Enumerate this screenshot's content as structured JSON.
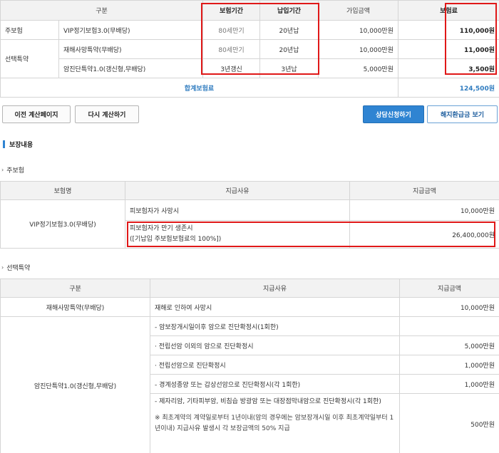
{
  "summary_table": {
    "headers": [
      "구분",
      "보험기간",
      "납입기간",
      "가입금액",
      "보험료"
    ],
    "rows": [
      {
        "category": "주보험",
        "product": "VIP정기보험3.0(무배당)",
        "period": "80세만기",
        "payment": "20년납",
        "amount": "10,000만원",
        "premium": "110,000원"
      },
      {
        "category": "선택특약",
        "product": "재해사망특약(무배당)",
        "period": "80세만기",
        "payment": "20년납",
        "amount": "10,000만원",
        "premium": "11,000원"
      },
      {
        "category": "",
        "product": "암진단특약1.0(갱신형,무배당)",
        "period": "3년갱신",
        "payment": "3년납",
        "amount": "5,000만원",
        "premium": "3,500원"
      }
    ],
    "total_label": "합계보험료",
    "total_value": "124,500원"
  },
  "buttons": {
    "prev": "이전 계산페이지",
    "recalc": "다시 계산하기",
    "consult": "상담신청하기",
    "refund": "해지환급금 보기"
  },
  "coverage": {
    "title": "보장내용",
    "main_label": "주보험",
    "main_table": {
      "headers": [
        "보험명",
        "지급사유",
        "지급금액"
      ],
      "product": "VIP정기보험3.0(무배당)",
      "rows": [
        {
          "reason": "피보험자가 사망시",
          "reason2": "",
          "amount": "10,000만원"
        },
        {
          "reason": "피보험자가 만기 생존시",
          "reason2": "([기납입 주보험보험료의 100%])",
          "amount": "26,400,000원"
        }
      ]
    },
    "rider_label": "선택특약",
    "rider_table": {
      "headers": [
        "구분",
        "지급사유",
        "지급금액"
      ],
      "rows": [
        {
          "name": "재해사망특약(무배당)",
          "reason": "재해로 인하여 사망시",
          "amount": "10,000만원"
        },
        {
          "name": "암진단특약1.0(갱신형,무배당)",
          "reason": "- 암보장개시일이후 암으로 진단확정시(1회한)",
          "amount": ""
        },
        {
          "name": "",
          "reason": "· 전립선암 이외의 암으로 진단확정시",
          "amount": "5,000만원"
        },
        {
          "name": "",
          "reason": "· 전립선암으로 진단확정시",
          "amount": "1,000만원"
        },
        {
          "name": "",
          "reason": "- 경계성종양 또는 갑상선암으로 진단확정시(각 1회한)",
          "amount": "1,000만원"
        },
        {
          "name": "",
          "reason": "- 제자리암, 기타피부암, 비침습 방광암 또는 대장점막내암으로 진단확정시(각 1회한)",
          "note": "※ 최초계약의 계약일로부터 1년이내(암의 경우에는 암보장개시일 이후 최초계약일부터 1년이내) 지급사유 발생시 각 보장금액의 50% 지급",
          "amount": "500만원"
        }
      ]
    }
  }
}
